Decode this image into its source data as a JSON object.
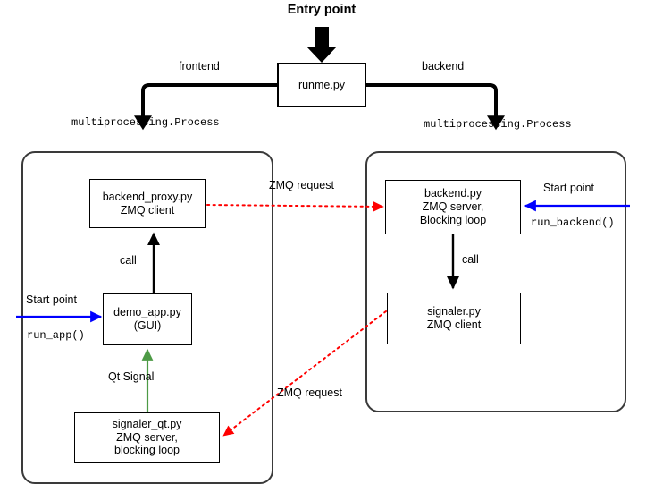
{
  "diagram": {
    "title": "Entry point",
    "entry": {
      "label": "Entry point",
      "node": "runme.py"
    },
    "branches": {
      "frontend_label": "frontend",
      "backend_label": "backend",
      "frontend_process": "multiprocessing.Process",
      "backend_process": "multiprocessing.Process"
    },
    "frontend_panel": {
      "nodes": [
        {
          "id": "backend_proxy",
          "text": "backend_proxy.py\nZMQ client"
        },
        {
          "id": "demo_app",
          "text": "demo_app.py\n(GUI)"
        },
        {
          "id": "signaler_qt",
          "text": "signaler_qt.py\nZMQ server,\nblocking loop"
        }
      ],
      "edges": [
        {
          "id": "call-edge",
          "label": "call"
        },
        {
          "id": "qt-signal-edge",
          "label": "Qt Signal"
        }
      ],
      "start": {
        "label": "Start point",
        "function": "run_app()"
      }
    },
    "backend_panel": {
      "nodes": [
        {
          "id": "backend",
          "text": "backend.py\nZMQ server,\nBlocking loop"
        },
        {
          "id": "signaler",
          "text": "signaler.py\nZMQ client"
        }
      ],
      "edges": [
        {
          "id": "call-edge",
          "label": "call"
        }
      ],
      "start": {
        "label": "Start point",
        "function": "run_backend()"
      }
    },
    "zmq_edges": [
      {
        "id": "zmq-request-top",
        "label": "ZMQ request"
      },
      {
        "id": "zmq-request-bottom",
        "label": "ZMQ request"
      }
    ],
    "colors": {
      "black": "#000000",
      "panel_border": "#3a3a3a",
      "blue": "#0000ff",
      "green": "#4c9a45",
      "red": "#ff0000",
      "background": "#ffffff"
    }
  }
}
